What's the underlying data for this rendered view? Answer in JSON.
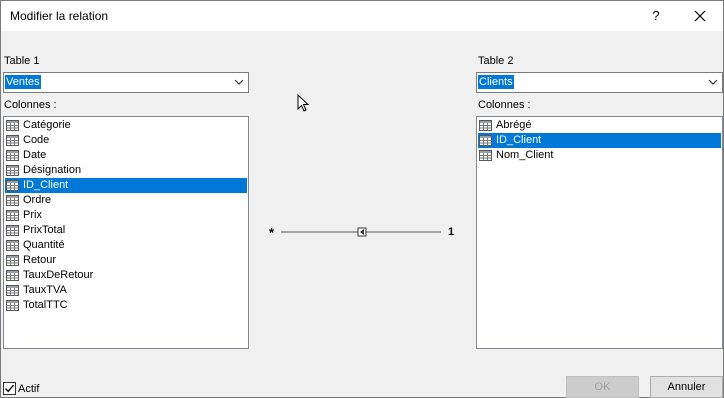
{
  "window": {
    "title": "Modifier la relation",
    "help_label": "?",
    "close_icon": "close-icon"
  },
  "left": {
    "table_label": "Table 1",
    "table_value": "Ventes",
    "columns_label": "Colonnes :",
    "columns": [
      "Catégorie",
      "Code",
      "Date",
      "Désignation",
      "ID_Client",
      "Ordre",
      "Prix",
      "PrixTotal",
      "Quantité",
      "Retour",
      "TauxDeRetour",
      "TauxTVA",
      "TotalTTC"
    ],
    "selected": "ID_Client"
  },
  "right": {
    "table_label": "Table 2",
    "table_value": "Clients",
    "columns_label": "Colonnes :",
    "columns": [
      "Abrégé",
      "ID_Client",
      "Nom_Client"
    ],
    "selected": "ID_Client"
  },
  "relation": {
    "left_cardinality": "*",
    "right_cardinality": "1"
  },
  "footer": {
    "active_label": "Actif",
    "active_checked": true,
    "ok_label": "OK",
    "ok_enabled": false,
    "cancel_label": "Annuler"
  },
  "colors": {
    "selection": "#0078d7",
    "dialog_bg": "#f0f0f0"
  }
}
